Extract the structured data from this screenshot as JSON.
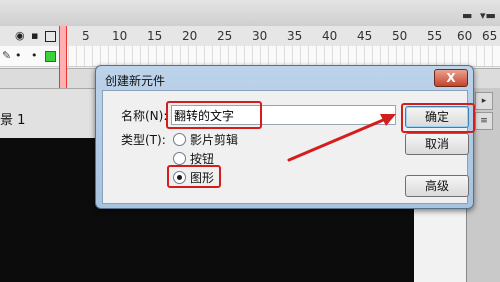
{
  "timeline": {
    "frame_numbers": [
      "5",
      "10",
      "15",
      "20",
      "25",
      "30",
      "35",
      "40",
      "45",
      "50",
      "55",
      "60",
      "65"
    ],
    "header_icons": [
      "eye-icon",
      "lock-icon",
      "outline-icon"
    ]
  },
  "scene": {
    "label": "景 1"
  },
  "dialog": {
    "title": "创建新元件",
    "close_label": "X",
    "name_label": "名称(N):",
    "name_value": "翻转的文字",
    "type_label": "类型(T):",
    "types": [
      {
        "label": "影片剪辑",
        "selected": false
      },
      {
        "label": "按钮",
        "selected": false
      },
      {
        "label": "图形",
        "selected": true
      }
    ],
    "ok_label": "确定",
    "cancel_label": "取消",
    "advanced_label": "高级"
  },
  "colors": {
    "annotation_red": "#d41e1e",
    "stage_bg": "#0c0c0c",
    "dialog_frame": "#a8c3df"
  }
}
